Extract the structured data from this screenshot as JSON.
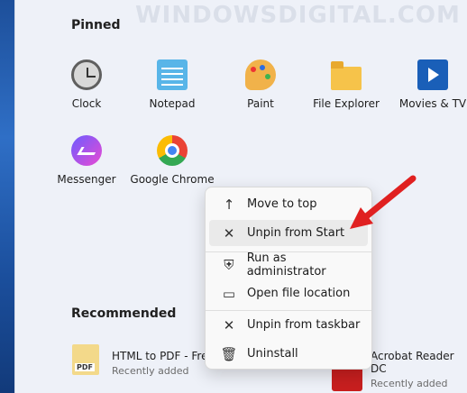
{
  "watermark": "WINDOWSDIGITAL.COM",
  "pinned": {
    "title": "Pinned",
    "apps": [
      {
        "label": "Clock",
        "icon": "clock-icon"
      },
      {
        "label": "Notepad",
        "icon": "notepad-icon"
      },
      {
        "label": "Paint",
        "icon": "paint-icon"
      },
      {
        "label": "File Explorer",
        "icon": "folder-icon"
      },
      {
        "label": "Movies & TV",
        "icon": "movies-tv-icon"
      },
      {
        "label": "Messenger",
        "icon": "messenger-icon"
      },
      {
        "label": "Google Chrome",
        "icon": "chrome-icon"
      }
    ]
  },
  "recommended": {
    "title": "Recommended",
    "items": [
      {
        "name": "HTML to PDF - Free",
        "status": "Recently added",
        "icon": "pdf-app-icon"
      },
      {
        "name": "Acrobat Reader DC",
        "status": "Recently added",
        "icon": "acrobat-icon"
      }
    ]
  },
  "context_menu": {
    "items": [
      {
        "label": "Move to top",
        "icon": "arrow-up-icon"
      },
      {
        "label": "Unpin from Start",
        "icon": "unpin-icon"
      },
      {
        "label": "Run as administrator",
        "icon": "shield-icon"
      },
      {
        "label": "Open file location",
        "icon": "folder-open-icon"
      },
      {
        "label": "Unpin from taskbar",
        "icon": "unpin-icon"
      },
      {
        "label": "Uninstall",
        "icon": "trash-icon"
      }
    ]
  },
  "colors": {
    "annotation_arrow": "#e02020",
    "background": "#eef1f8",
    "menu_background": "#f9f9f9"
  }
}
